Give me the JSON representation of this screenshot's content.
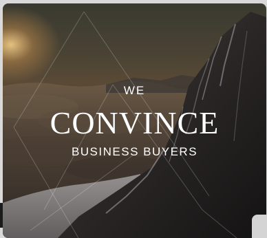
{
  "hero": {
    "kicker": "WE",
    "headline": "CONVINCE",
    "subline": "BUSINESS BUYERS"
  },
  "colors": {
    "text": "#ffffff",
    "sun_glow": "#ffd68c",
    "cloud_tone": "#6b5a47",
    "mountain_dark": "#1c1a1a",
    "snow": "#c9c9cc"
  }
}
